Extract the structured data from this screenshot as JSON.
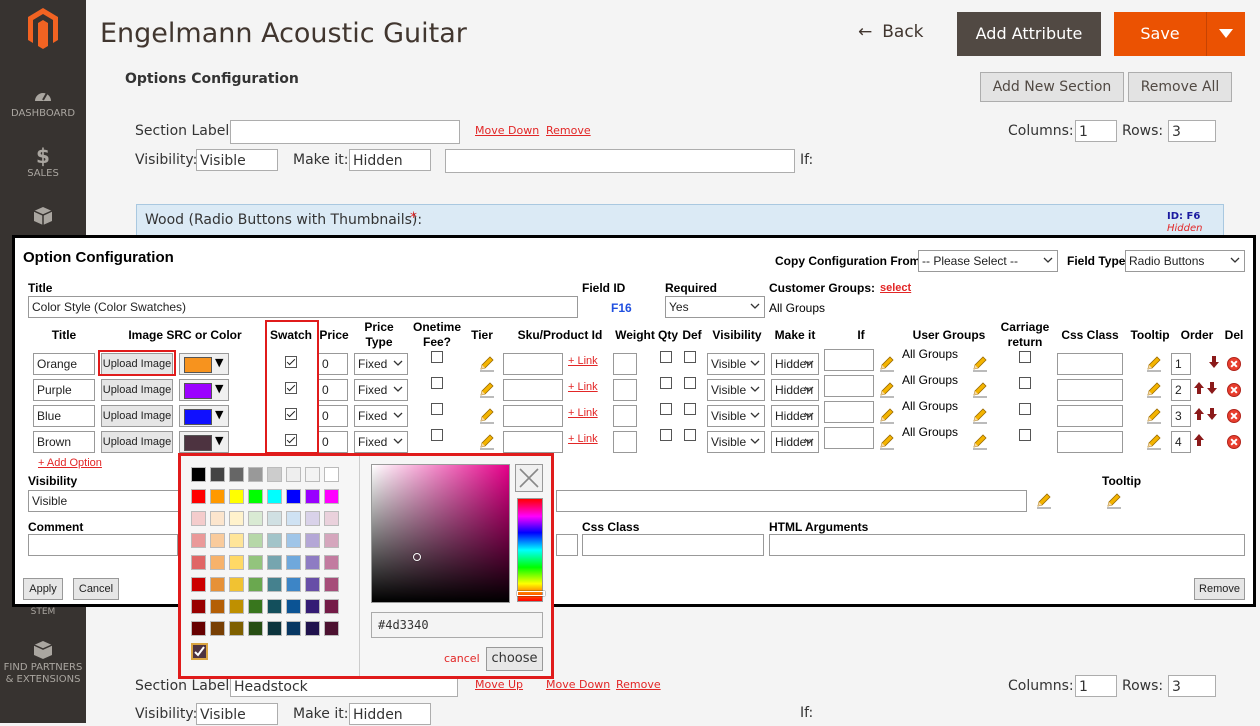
{
  "app": {
    "page_title": "Engelmann Acoustic Guitar",
    "back_label": "Back",
    "add_attribute_label": "Add Attribute",
    "save_label": "Save"
  },
  "sidebar": {
    "items": [
      {
        "label": "DASHBOARD",
        "icon": "dashboard-icon"
      },
      {
        "label": "SALES",
        "icon": "dollar-icon"
      },
      {
        "label": "",
        "icon": "box-icon"
      },
      {
        "label": "FIND PARTNERS & EXTENSIONS",
        "icon": "partners-icon"
      }
    ],
    "footer_partial": "STEM"
  },
  "background": {
    "section_title": "Options Configuration",
    "add_section_label": "Add New Section",
    "remove_all_label": "Remove All",
    "section_label_text": "Section Label:",
    "move_down": "Move Down",
    "move_up": "Move Up",
    "remove": "Remove",
    "columns_label": "Columns:",
    "columns_value": "1",
    "rows_label": "Rows:",
    "rows_value": "3",
    "visibility_label": "Visibility:",
    "visibility_value": "Visible",
    "make_it_label": "Make it:",
    "make_it_value": "Hidden",
    "if_label": "If:",
    "wood_title": "Wood (Radio Buttons with Thumbnails):",
    "required_star": "*",
    "wood_id": "ID: F6",
    "wood_hidden": "Hidden",
    "bottom_section_value": "Headstock"
  },
  "modal": {
    "title": "Option Configuration",
    "copy_label": "Copy Configuration From:",
    "copy_value": "-- Please Select --",
    "field_type_label": "Field Type:",
    "field_type_value": "Radio Buttons",
    "title_label": "Title",
    "title_value": "Color Style (Color Swatches)",
    "field_id_label": "Field ID",
    "field_id_value": "F16",
    "required_label": "Required",
    "required_value": "Yes",
    "customer_groups_label": "Customer Groups:",
    "customer_groups_link": "select",
    "customer_groups_value": "All Groups",
    "columns": {
      "title": "Title",
      "image_src": "Image SRC or Color",
      "swatch": "Swatch",
      "price": "Price",
      "price_type": "Price Type",
      "onetime_fee": "Onetime Fee?",
      "tier": "Tier",
      "sku": "Sku/Product Id",
      "weight": "Weight",
      "qty": "Qty",
      "def": "Def",
      "visibility": "Visibility",
      "make_it": "Make it",
      "if": "If",
      "user_groups": "User Groups",
      "carriage_return": "Carriage return",
      "css_class": "Css Class",
      "tooltip": "Tooltip",
      "order": "Order",
      "del": "Del"
    },
    "rows": [
      {
        "title": "Orange",
        "upload": "Upload Image",
        "color": "#f7931e",
        "swatch": true,
        "price": "0",
        "price_type": "Fixed",
        "link": "+ Link",
        "visibility": "Visible",
        "make_it": "Hidden",
        "user_groups": "All Groups",
        "order": "1"
      },
      {
        "title": "Purple",
        "upload": "Upload Image",
        "color": "#9b00ff",
        "swatch": true,
        "price": "0",
        "price_type": "Fixed",
        "link": "+ Link",
        "visibility": "Visible",
        "make_it": "Hidden",
        "user_groups": "All Groups",
        "order": "2"
      },
      {
        "title": "Blue",
        "upload": "Upload Image",
        "color": "#1010ff",
        "swatch": true,
        "price": "0",
        "price_type": "Fixed",
        "link": "+ Link",
        "visibility": "Visible",
        "make_it": "Hidden",
        "user_groups": "All Groups",
        "order": "3"
      },
      {
        "title": "Brown",
        "upload": "Upload Image",
        "color": "#4d3340",
        "swatch": true,
        "price": "0",
        "price_type": "Fixed",
        "link": "+ Link",
        "visibility": "Visible",
        "make_it": "Hidden",
        "user_groups": "All Groups",
        "order": "4"
      }
    ],
    "add_option": "+ Add Option",
    "visibility_label": "Visibility",
    "visibility_value": "Visible",
    "tooltip_label": "Tooltip",
    "comment_label": "Comment",
    "css_class_label": "Css Class",
    "html_args_label": "HTML Arguments",
    "apply_label": "Apply",
    "cancel_label": "Cancel",
    "remove_label": "Remove"
  },
  "picker": {
    "hex_value": "#4d3340",
    "cancel_label": "cancel",
    "choose_label": "choose",
    "palette": [
      [
        "#000000",
        "#444444",
        "#666666",
        "#999999",
        "#cccccc",
        "#eeeeee",
        "#f3f3f3",
        "#ffffff"
      ],
      [
        "#ff0000",
        "#ff9900",
        "#ffff00",
        "#00ff00",
        "#00ffff",
        "#0000ff",
        "#9900ff",
        "#ff00ff"
      ],
      [
        "#f4cccc",
        "#fce5cd",
        "#fff2cc",
        "#d9ead3",
        "#d0e0e3",
        "#cfe2f3",
        "#d9d2e9",
        "#ead1dc"
      ],
      [
        "#ea9999",
        "#f9cb9c",
        "#ffe599",
        "#b6d7a8",
        "#a2c4c9",
        "#9fc5e8",
        "#b4a7d6",
        "#d5a6bd"
      ],
      [
        "#e06666",
        "#f6b26b",
        "#ffd966",
        "#93c47d",
        "#76a5af",
        "#6fa8dc",
        "#8e7cc3",
        "#c27ba0"
      ],
      [
        "#cc0000",
        "#e69138",
        "#f1c232",
        "#6aa84f",
        "#45818e",
        "#3d85c6",
        "#674ea7",
        "#a64d79"
      ],
      [
        "#990000",
        "#b45f06",
        "#bf9000",
        "#38761d",
        "#134f5c",
        "#0b5394",
        "#351c75",
        "#741b47"
      ],
      [
        "#660000",
        "#783f04",
        "#7f6000",
        "#274e13",
        "#0c343d",
        "#073763",
        "#20124d",
        "#4c1130"
      ]
    ],
    "selected_color": "#4d3340"
  }
}
